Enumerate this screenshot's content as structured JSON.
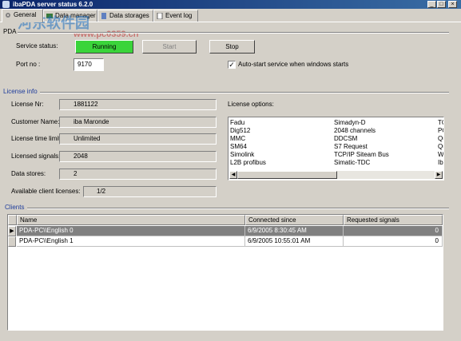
{
  "window": {
    "title": "ibaPDA server status  6.2.0",
    "controls": [
      "_",
      "□",
      "×"
    ]
  },
  "tabs": [
    {
      "label": "General",
      "icon": "gear-icon",
      "active": true
    },
    {
      "label": "Data manager",
      "icon": "data-manager-icon",
      "active": false
    },
    {
      "label": "Data storages",
      "icon": "data-storage-icon",
      "active": false
    },
    {
      "label": "Event log",
      "icon": "event-log-icon",
      "active": false
    }
  ],
  "watermark": {
    "text": "河东软件园",
    "url": "www.pc0359.cn"
  },
  "service": {
    "group_label": "PDA",
    "status_label": "Service status:",
    "status_value": "Running",
    "start_label": "Start",
    "stop_label": "Stop",
    "port_label": "Port no :",
    "port_value": "9170",
    "autostart_label": "Auto-start service when windows starts",
    "autostart_checked": true
  },
  "license": {
    "group_label": "License info",
    "nr_label": "License Nr:",
    "nr_value": "1881122",
    "customer_label": "Customer Name:",
    "customer_value": "iba Maronde",
    "time_label": "License time limit:",
    "time_value": "Unlimited",
    "signals_label": "Licensed signals:",
    "signals_value": "2048",
    "stores_label": "Data stores:",
    "stores_value": "2",
    "clients_label": "Available client licenses:",
    "clients_value": "1/2",
    "options_label": "License options:",
    "options_col1": [
      "Fadu",
      "Dig512",
      "MMC",
      "SM64",
      "Simolink",
      "L2B profibus"
    ],
    "options_col2": [
      "Simadyn-D",
      "2048 channels",
      "DDCSM",
      "S7 Request",
      "TCP/IP Siteam Bus",
      "Simatic-TDC"
    ],
    "options_col3": [
      "TC",
      "PC",
      "Qu",
      "Qu",
      "W",
      "Ib"
    ]
  },
  "clients": {
    "group_label": "Clients",
    "columns": [
      "Name",
      "Connected since",
      "Requested signals"
    ],
    "rows": [
      {
        "name": "PDA-PC\\\\English 0",
        "since": "6/9/2005 8:30:45 AM",
        "signals": "0",
        "selected": true
      },
      {
        "name": "PDA-PC\\\\English 1",
        "since": "6/9/2005 10:55:01 AM",
        "signals": "0",
        "selected": false
      }
    ],
    "row_indicator": "▶"
  }
}
